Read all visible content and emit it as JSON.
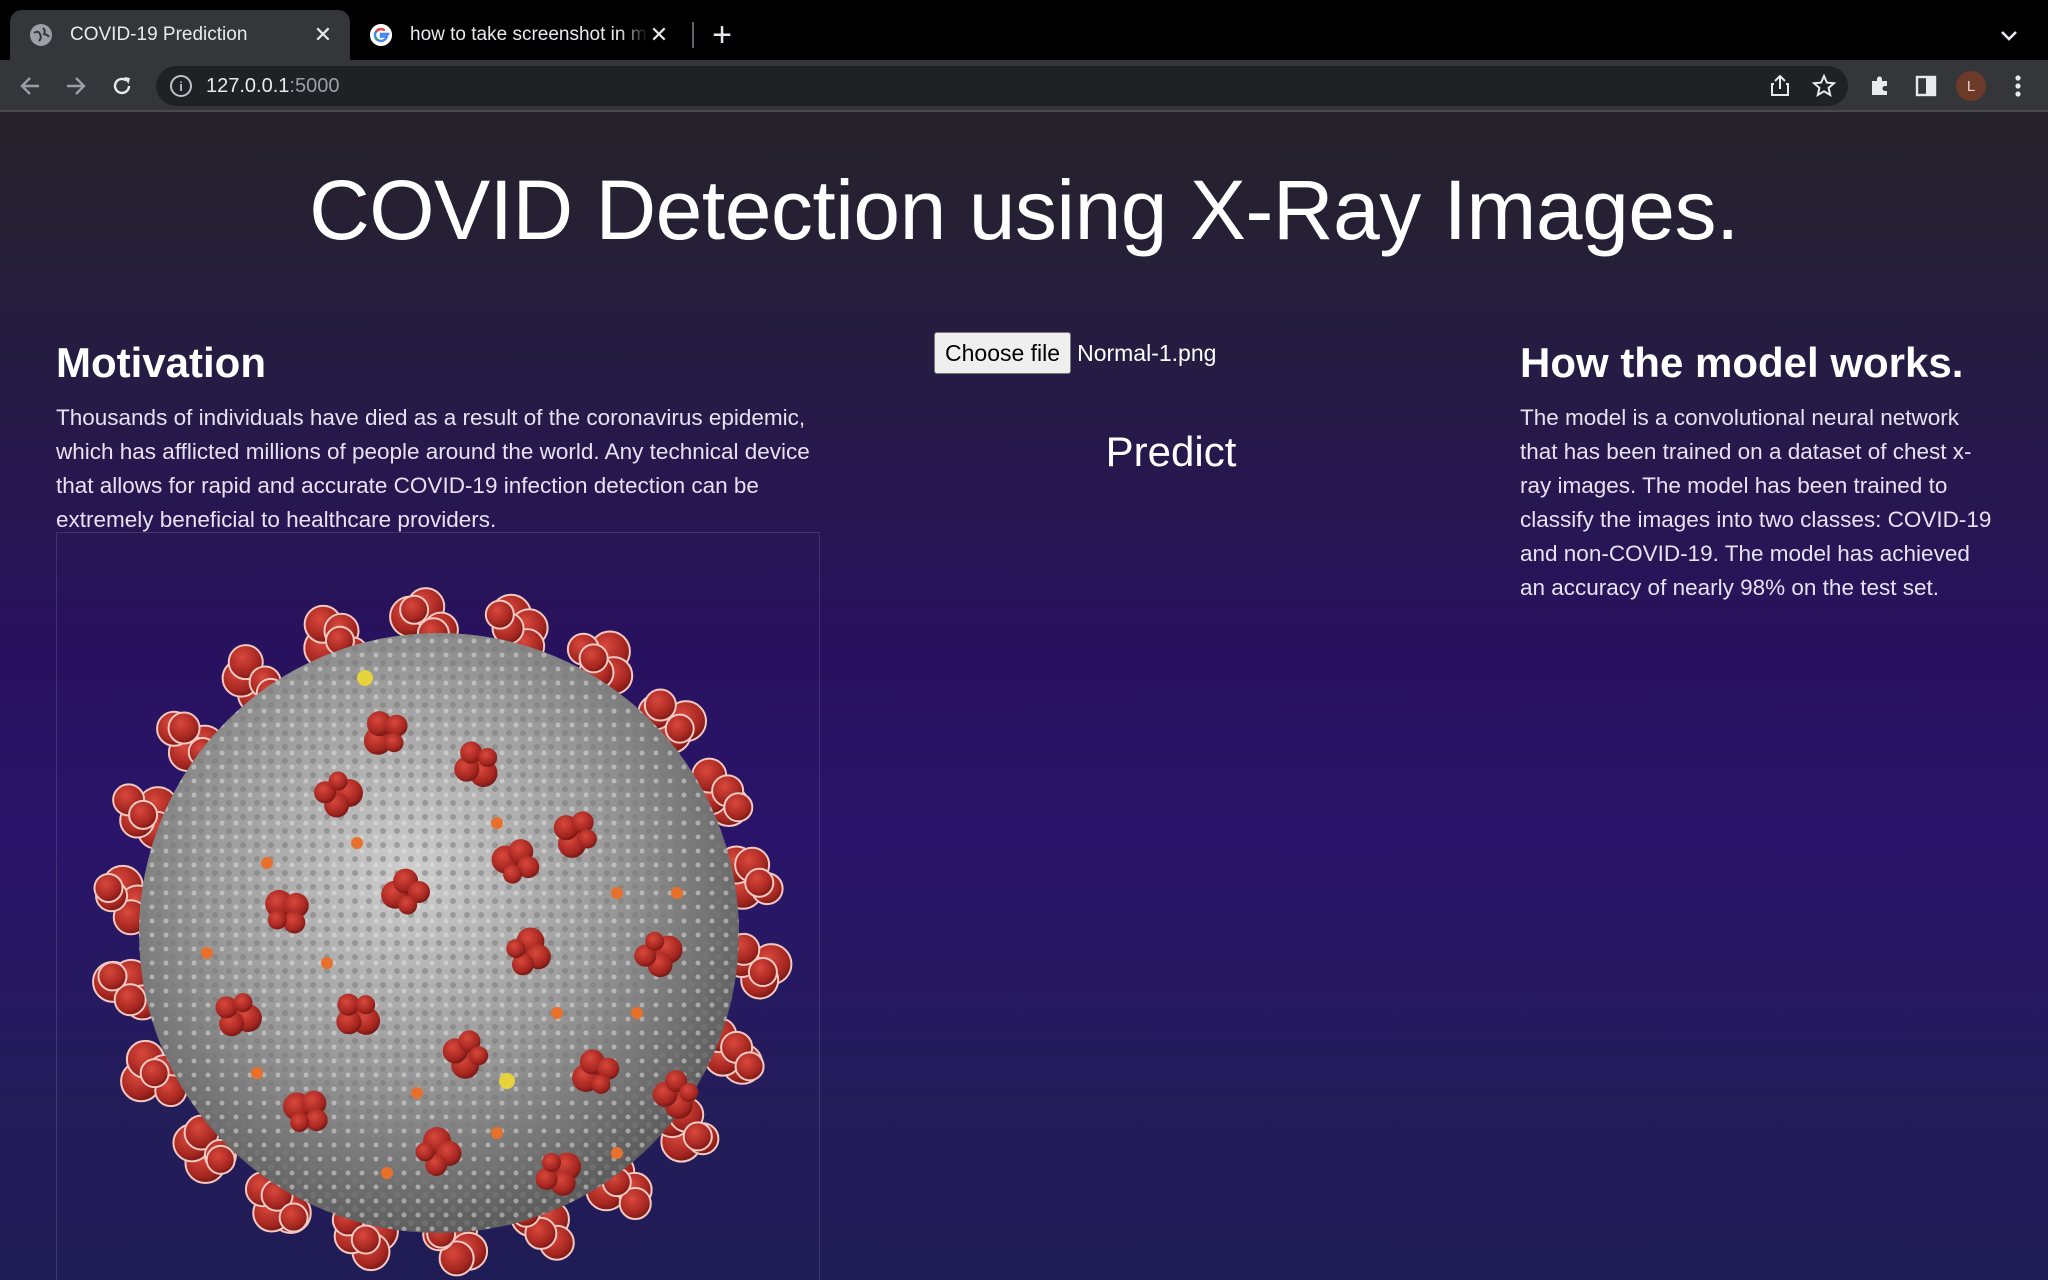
{
  "browser": {
    "tabs": [
      {
        "title": "COVID-19 Prediction",
        "active": true,
        "favicon": "globe-icon"
      },
      {
        "title": "how to take screenshot in mac",
        "active": false,
        "favicon": "google-icon"
      }
    ],
    "close_glyph": "✕",
    "new_tab_glyph": "+",
    "url_host": "127.0.0.1",
    "url_port": ":5000",
    "avatar_letter": "L"
  },
  "page": {
    "title": "COVID Detection using X-Ray Images.",
    "motivation": {
      "heading": "Motivation",
      "text": "Thousands of individuals have died as a result of the coronavirus epidemic, which has afflicted millions of people around the world. Any technical device that allows for rapid and accurate COVID-19 infection detection can be extremely beneficial to healthcare providers."
    },
    "upload": {
      "button_label": "Choose file",
      "file_name": "Normal-1.png"
    },
    "predict_label": "Predict",
    "model": {
      "heading": "How the model works.",
      "text": "The model is a convolutional neural network that has been trained on a dataset of chest x-ray images. The model has been trained to classify the images into two classes: COVID-19 and non-COVID-19. The model has achieved an accuracy of nearly 98% on the test set."
    }
  },
  "colors": {
    "spike": "#b8312a",
    "virus_body": "#9b9b9b",
    "orange_dot": "#e8702a",
    "yellow_dot": "#e6d23a"
  }
}
